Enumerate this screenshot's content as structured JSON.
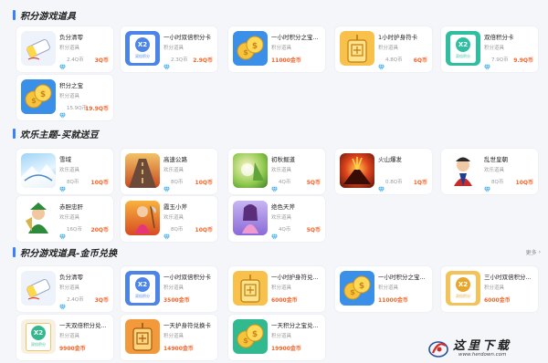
{
  "section1": {
    "title": "积分游戏道具",
    "cards": [
      {
        "name": "负分清零",
        "sub": "积分道具",
        "amount": "2.4Q币",
        "price": "3Q币",
        "icon": "eraser-icon"
      },
      {
        "name": "一小时双倍积分卡",
        "sub": "积分道具",
        "amount": "2.3Q币",
        "price": "2.9Q币",
        "icon": "x2-card-icon",
        "icon_label": "双倍积分"
      },
      {
        "name": "一小时积分之宝...",
        "sub": "积分道具",
        "gold": "11000金币",
        "icon": "coin-icon"
      },
      {
        "name": "1小时护身符卡",
        "sub": "积分道具",
        "amount": "4.8Q币",
        "price": "6Q币",
        "icon": "amulet-icon"
      },
      {
        "name": "双倍积分卡",
        "sub": "积分道具",
        "amount": "7.9Q币",
        "price": "9.9Q币",
        "icon": "x2-green-icon",
        "icon_label": "双倍积分"
      },
      {
        "name": "积分之宝",
        "sub": "积分道具",
        "amount": "15.9Q币",
        "price": "19.9Q币",
        "icon": "coin-icon"
      }
    ]
  },
  "section2": {
    "title": "欢乐主题-买就送豆",
    "cards": [
      {
        "name": "雪域",
        "sub": "欢乐道具",
        "amount": "8Q币",
        "price": "10Q币",
        "icon": "snow-theme-icon"
      },
      {
        "name": "高速公路",
        "sub": "欢乐道具",
        "amount": "8Q币",
        "price": "10Q币",
        "icon": "highway-theme-icon"
      },
      {
        "name": "初秋掘道",
        "sub": "欢乐道具",
        "amount": "4Q币",
        "price": "5Q币",
        "icon": "autumn-theme-icon"
      },
      {
        "name": "火山爆发",
        "sub": "",
        "amount": "0.8Q币",
        "price": "1Q币",
        "icon": "volcano-theme-icon"
      },
      {
        "name": "乱世皇朝",
        "sub": "欢乐道具",
        "amount": "8Q币",
        "price": "10Q币",
        "icon": "emperor-theme-icon"
      },
      {
        "name": "赤胆忠肝",
        "sub": "欢乐道具",
        "amount": "16Q币",
        "price": "20Q币",
        "icon": "general-theme-icon"
      },
      {
        "name": "霞玉小斧",
        "sub": "欢乐道具",
        "amount": "8Q币",
        "price": "10Q币",
        "icon": "axe-theme-icon"
      },
      {
        "name": "绝色天斧",
        "sub": "欢乐道具",
        "amount": "4Q币",
        "price": "5Q币",
        "icon": "beauty-theme-icon"
      }
    ]
  },
  "section3": {
    "title": "积分游戏道具-金币兑换",
    "more": "更多",
    "cards": [
      {
        "name": "负分清零",
        "sub": "积分道具",
        "amount": "2.4Q币",
        "price": "3Q币",
        "icon": "eraser-icon"
      },
      {
        "name": "一小时双倍积分卡",
        "sub": "积分道具",
        "gold": "3500金币",
        "icon": "x2-card-icon",
        "icon_label": "双倍积分"
      },
      {
        "name": "一小时护身符兑...",
        "sub": "积分道具",
        "gold": "6000金币",
        "icon": "amulet-icon"
      },
      {
        "name": "一小时积分之宝...",
        "sub": "积分道具",
        "gold": "11000金币",
        "icon": "coin-icon"
      },
      {
        "name": "三小时双倍积分...",
        "sub": "积分道具",
        "gold": "6000金币",
        "icon": "x2-gold-icon",
        "icon_label": "双倍积分"
      },
      {
        "name": "一天双倍积分兑...",
        "sub": "积分道具",
        "gold": "9900金币",
        "icon": "x2-orange-icon",
        "icon_label": "双倍积分"
      },
      {
        "name": "一天护身符兑换卡",
        "sub": "积分道具",
        "gold": "14900金币",
        "icon": "amulet-orange-icon"
      },
      {
        "name": "一天积分之宝兑...",
        "sub": "积分道具",
        "gold": "19900金币",
        "icon": "coin-green-icon"
      }
    ]
  },
  "watermark": {
    "title": "这里下载",
    "url": "www.herdown.com"
  }
}
